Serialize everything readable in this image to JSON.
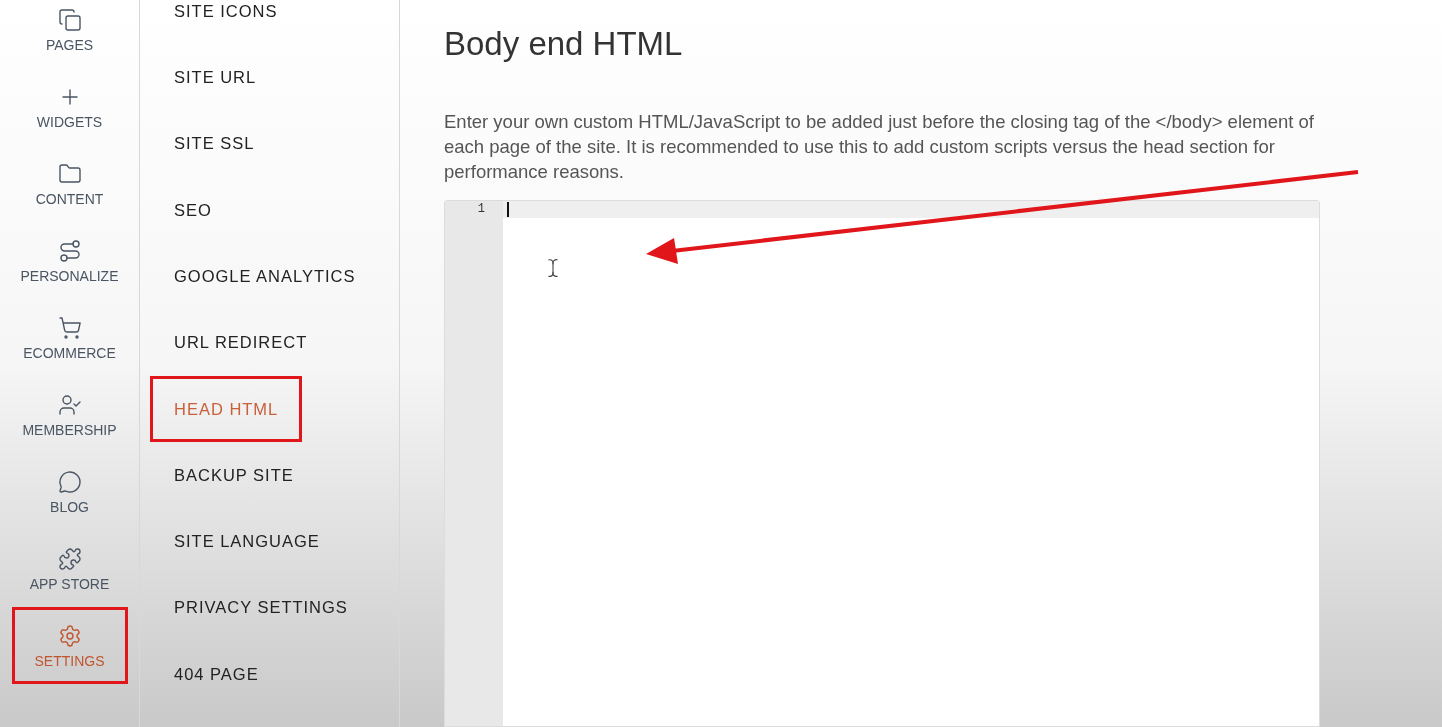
{
  "nav_rail": {
    "items": [
      {
        "label": "PAGES",
        "selected": false,
        "annotated": false
      },
      {
        "label": "WIDGETS",
        "selected": false,
        "annotated": false
      },
      {
        "label": "CONTENT",
        "selected": false,
        "annotated": false
      },
      {
        "label": "PERSONALIZE",
        "selected": false,
        "annotated": false
      },
      {
        "label": "ECOMMERCE",
        "selected": false,
        "annotated": false
      },
      {
        "label": "MEMBERSHIP",
        "selected": false,
        "annotated": false
      },
      {
        "label": "BLOG",
        "selected": false,
        "annotated": false
      },
      {
        "label": "APP STORE",
        "selected": false,
        "annotated": false
      },
      {
        "label": "SETTINGS",
        "selected": true,
        "annotated": true
      }
    ]
  },
  "settings_menu": {
    "items": [
      {
        "label": "SITE ICONS",
        "selected": false,
        "annotated": false
      },
      {
        "label": "SITE URL",
        "selected": false,
        "annotated": false
      },
      {
        "label": "SITE SSL",
        "selected": false,
        "annotated": false
      },
      {
        "label": "SEO",
        "selected": false,
        "annotated": false
      },
      {
        "label": "GOOGLE ANALYTICS",
        "selected": false,
        "annotated": false
      },
      {
        "label": "URL REDIRECT",
        "selected": false,
        "annotated": false
      },
      {
        "label": "HEAD HTML",
        "selected": true,
        "annotated": true
      },
      {
        "label": "BACKUP SITE",
        "selected": false,
        "annotated": false
      },
      {
        "label": "SITE LANGUAGE",
        "selected": false,
        "annotated": false
      },
      {
        "label": "PRIVACY SETTINGS",
        "selected": false,
        "annotated": false
      },
      {
        "label": "404 PAGE",
        "selected": false,
        "annotated": false
      }
    ]
  },
  "main": {
    "title": "Body end HTML",
    "description": "Enter your own custom HTML/JavaScript to be added just before the closing tag of the </body> element of each page of the site. It is recommended to use this to add custom scripts versus the head section for performance reasons.",
    "editor": {
      "line_numbers": [
        "1"
      ]
    }
  },
  "annotation": {
    "arrow": true
  }
}
